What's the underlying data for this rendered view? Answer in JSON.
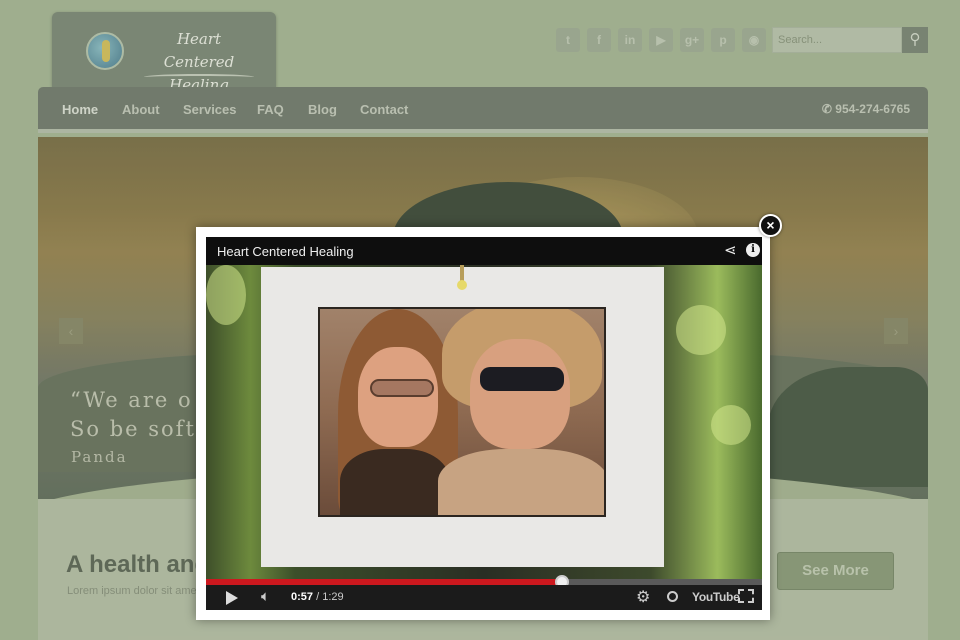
{
  "site": {
    "logo": {
      "line1": "Heart Centered",
      "line2": "Healing"
    },
    "social_icons": [
      {
        "name": "twitter-icon",
        "glyph": "t"
      },
      {
        "name": "facebook-icon",
        "glyph": "f"
      },
      {
        "name": "linkedin-icon",
        "glyph": "in"
      },
      {
        "name": "youtube-icon",
        "glyph": "▶"
      },
      {
        "name": "google-plus-icon",
        "glyph": "g+"
      },
      {
        "name": "pinterest-icon",
        "glyph": "p"
      },
      {
        "name": "rss-icon",
        "glyph": "◉"
      }
    ],
    "search": {
      "placeholder": "Search..."
    },
    "nav": {
      "items": [
        "Home",
        "About",
        "Services",
        "FAQ",
        "Blog",
        "Contact"
      ],
      "phone": "954-274-6765"
    },
    "hero": {
      "quote_line1": "“We are o",
      "quote_line2": "So be soft",
      "quote_by": "Panda"
    },
    "headline": "A health and",
    "lorem": "Lorem ipsum dolor sit amet",
    "see_more": "See More"
  },
  "lightbox": {
    "close_glyph": "×",
    "video": {
      "title": "Heart Centered Healing",
      "current_time": "0:57",
      "duration": "1:29",
      "progress_fraction": 0.64,
      "youtube_label": "YouTube"
    }
  },
  "colors": {
    "progress": "#cc181e",
    "nav_bg": "#757d70",
    "page_bg": "#a9b897"
  }
}
